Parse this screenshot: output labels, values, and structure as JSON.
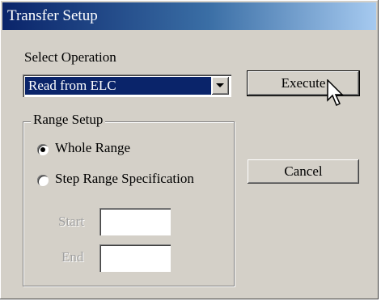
{
  "window": {
    "title": "Transfer Setup"
  },
  "operation": {
    "label": "Select Operation",
    "selected": "Read from ELC"
  },
  "buttons": {
    "execute": "Execute",
    "cancel": "Cancel"
  },
  "range_setup": {
    "legend": "Range Setup",
    "options": [
      {
        "label": "Whole Range",
        "checked": true
      },
      {
        "label": "Step Range Specification",
        "checked": false
      }
    ],
    "start_label": "Start",
    "end_label": "End",
    "start_value": "",
    "end_value": ""
  },
  "colors": {
    "title_gradient_start": "#0a246a",
    "title_gradient_end": "#a6caf0",
    "selection": "#0a246a",
    "face": "#d4d0c8"
  }
}
